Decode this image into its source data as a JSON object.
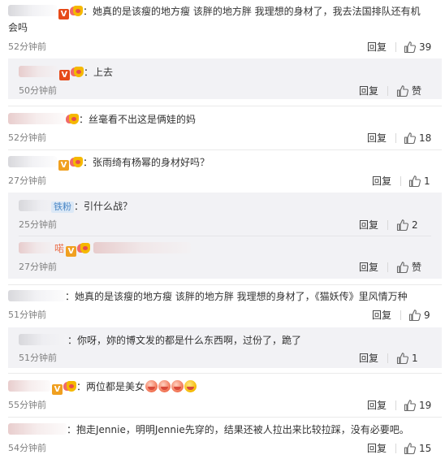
{
  "comments": [
    {
      "text": "：她真的是该瘦的地方瘦 该胖的地方胖   我理想的身材了，我去法国排队还有机",
      "text2": "会吗",
      "time": "52分钟前",
      "reply": "回复",
      "likes": "39"
    },
    {
      "text": "：上去",
      "time": "50分钟前",
      "reply": "回复",
      "likes": "赞"
    },
    {
      "text": "：丝毫看不出这是俩娃的妈",
      "time": "52分钟前",
      "reply": "回复",
      "likes": "18"
    },
    {
      "text": "：张雨绮有杨幂的身材好吗？",
      "time": "27分钟前",
      "reply": "回复",
      "likes": "1"
    },
    {
      "tag": "铁粉",
      "text": "：引什么战？",
      "time": "25分钟前",
      "reply": "回复",
      "likes": "2"
    },
    {
      "name_fragment": "喏",
      "text": "",
      "time": "27分钟前",
      "reply": "回复",
      "likes": "赞"
    },
    {
      "text": "：她真的是该瘦的地方瘦 该胖的地方胖   我理想的身材了，《猫妖传》里风情万种",
      "time": "51分钟前",
      "reply": "回复",
      "likes": "9"
    },
    {
      "text": "：你呀，妳的博文发的都是什么东西啊，过份了，跪了",
      "time": "51分钟前",
      "reply": "回复",
      "likes": "1"
    },
    {
      "text": "：两位都是美女",
      "time": "55分钟前",
      "reply": "回复",
      "likes": "19"
    },
    {
      "text": "：抱走Jennie，明明Jennie先穿的，结果还被人拉出来比较拉踩，没有必要吧。",
      "time": "54分钟前",
      "reply": "回复",
      "likes": "15"
    }
  ],
  "colors": {
    "link": "#eb7350",
    "muted": "#808080",
    "reply_bg": "#f2f2f5",
    "divider": "#eaeaea"
  },
  "icons": {
    "like": "thumbs-up-icon",
    "verified": "v-badge-icon",
    "fan_badge": "fan-heart-badge-icon",
    "emoji": "smile-face-emoji"
  }
}
